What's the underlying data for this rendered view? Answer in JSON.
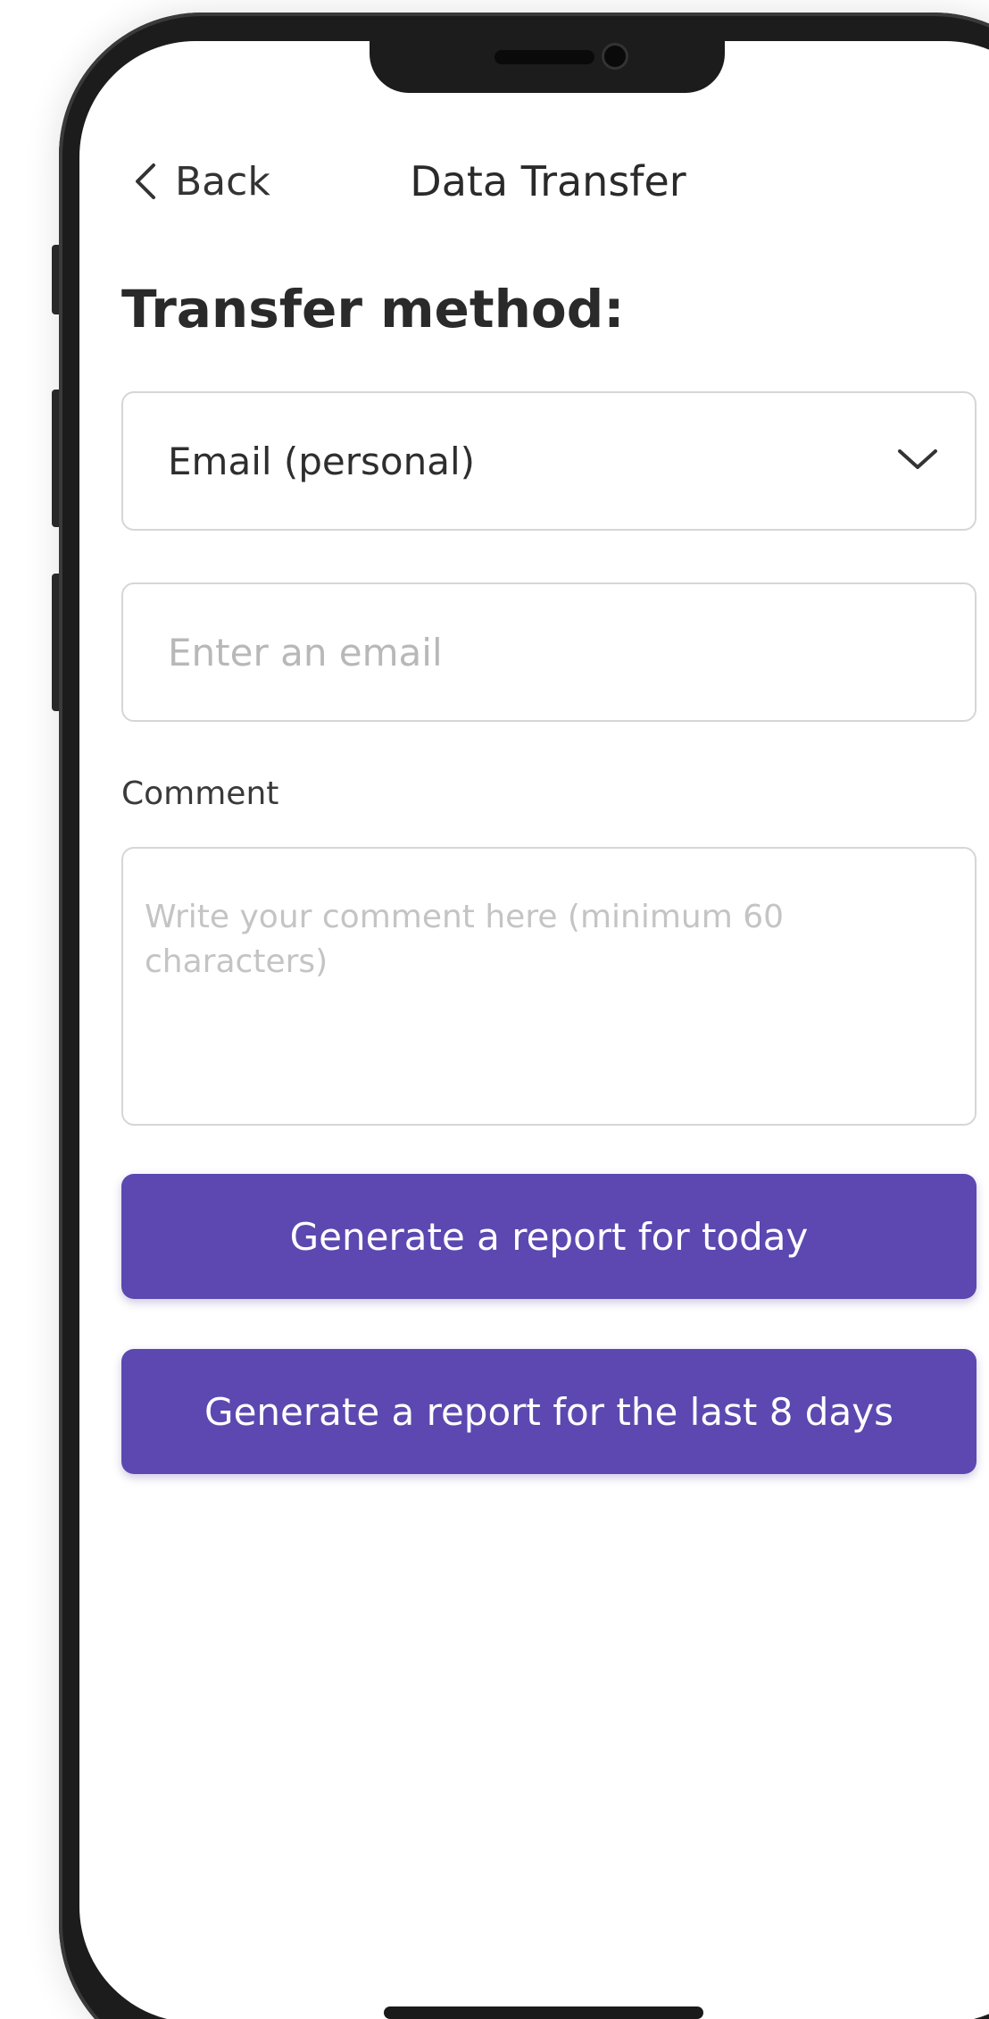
{
  "header": {
    "back_label": "Back",
    "title": "Data Transfer"
  },
  "form": {
    "heading": "Transfer method:",
    "method_select": {
      "value": "Email (personal)"
    },
    "email_input": {
      "placeholder": "Enter an email",
      "value": ""
    },
    "comment": {
      "label": "Comment",
      "placeholder": "Write your comment here (minimum 60 characters)",
      "value": ""
    }
  },
  "actions": {
    "report_today_label": "Generate a report for today",
    "report_8_days_label": "Generate a report for the last 8 days"
  },
  "icons": {
    "back": "chevron-left-icon",
    "select": "chevron-down-icon"
  },
  "colors": {
    "primary": "#5c48b0",
    "border": "#d6d6d6",
    "text": "#2a2a2a",
    "placeholder": "#b8b8b8"
  }
}
